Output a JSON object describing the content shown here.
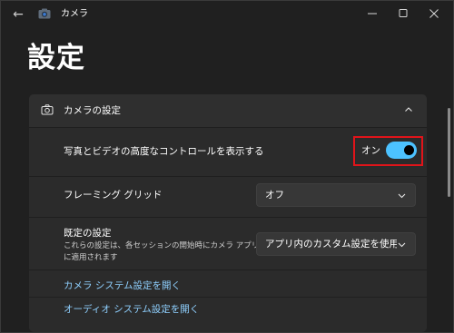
{
  "window": {
    "app_title": "カメラ"
  },
  "page": {
    "title": "設定"
  },
  "camera_settings": {
    "header_label": "カメラの設定",
    "advanced_controls": {
      "label": "写真とビデオの高度なコントロールを表示する",
      "state_label": "オン",
      "enabled": true
    },
    "framing_grid": {
      "label": "フレーミング グリッド",
      "value": "オフ"
    },
    "default_settings": {
      "label": "既定の設定",
      "description_line1": "これらの設定は、各セッションの開始時にカメラ アプリ",
      "description_line2": "に適用されます",
      "value": "アプリ内のカスタム設定を使用す"
    },
    "links": {
      "camera_system_settings": "カメラ システム設定を開く",
      "audio_system_settings": "オーディオ システム設定を開く"
    }
  },
  "icons": {
    "back": "back-arrow-icon",
    "app": "camera-icon",
    "section": "camera-outline-icon"
  },
  "colors": {
    "accent": "#4cc2ff",
    "link": "#8fd0ff",
    "highlight": "#e0141a"
  }
}
